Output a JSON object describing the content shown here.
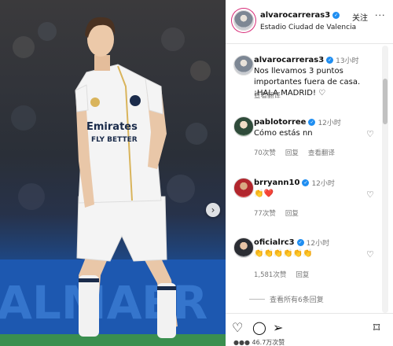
{
  "post": {
    "username": "alvarocarreras3",
    "location": "Estadio Ciudad de Valencia",
    "follow_label": "关注",
    "more_label": "···"
  },
  "comments": [
    {
      "username": "alvarocarreras3",
      "verified": true,
      "time": "13小时",
      "text": "Nos llevamos 3 puntos importantes fuera de casa. ¡HALA MADRID! ♡",
      "translate": "查看翻译"
    },
    {
      "username": "pablotorree",
      "verified": true,
      "time": "12小时",
      "text": "Cómo estás nn",
      "likes": "70次赞",
      "reply": "回复",
      "translate": "查看翻译"
    },
    {
      "username": "brryann10",
      "verified": true,
      "time": "12小时",
      "text": "👏❤️",
      "likes": "77次赞",
      "reply": "回复"
    },
    {
      "username": "oficialrc3",
      "verified": true,
      "time": "12小时",
      "text": "👏👏👏👏👏👏",
      "likes": "1,581次赞",
      "reply": "回复"
    }
  ],
  "view_replies": "查看所有6条回复",
  "actions": {
    "like_icon": "heart-icon",
    "comment_icon": "comment-icon",
    "share_icon": "share-icon",
    "save_icon": "bookmark-icon"
  },
  "likes_line": "●●● 46.7万次赞",
  "colors": {
    "verified": "#1f8ef1",
    "jersey": "#f4f4f4",
    "pitch_banner": "#1c4b8f"
  }
}
